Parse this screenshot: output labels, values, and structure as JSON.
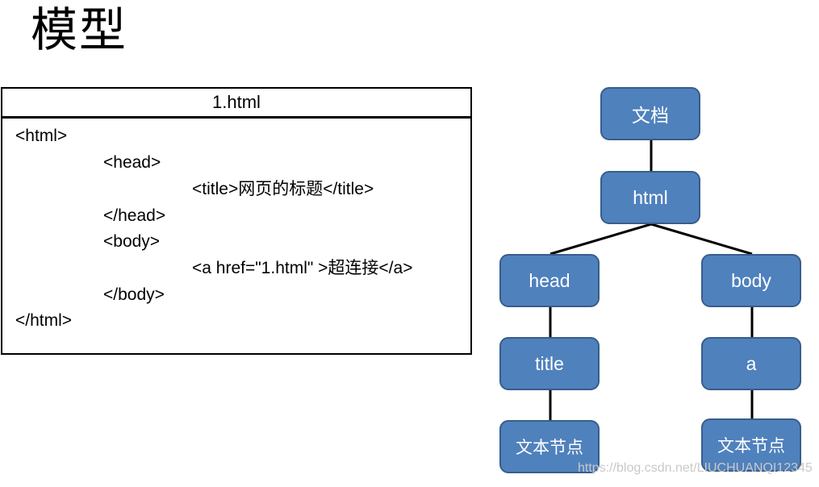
{
  "heading": "模型",
  "code_box": {
    "filename": "1.html",
    "lines": [
      "<html>",
      "<head>",
      "<title>网页的标题</title>",
      "</head>",
      "<body>",
      "<a href=\"1.html\" >超连接</a>",
      "</body>",
      "</html>"
    ]
  },
  "tree": {
    "node_color": "#4f81bd",
    "node_border_color": "#385d8a",
    "nodes": [
      {
        "id": "document",
        "label": "文档"
      },
      {
        "id": "html",
        "label": "html"
      },
      {
        "id": "head",
        "label": "head"
      },
      {
        "id": "body",
        "label": "body"
      },
      {
        "id": "title",
        "label": "title"
      },
      {
        "id": "a",
        "label": "a"
      },
      {
        "id": "text-title",
        "label": "文本节点"
      },
      {
        "id": "text-a",
        "label": "文本节点"
      }
    ],
    "edges": [
      [
        "document",
        "html"
      ],
      [
        "html",
        "head"
      ],
      [
        "html",
        "body"
      ],
      [
        "head",
        "title"
      ],
      [
        "body",
        "a"
      ],
      [
        "title",
        "text-title"
      ],
      [
        "a",
        "text-a"
      ]
    ]
  },
  "watermark": "https://blog.csdn.net/LIUCHUANQI12345"
}
